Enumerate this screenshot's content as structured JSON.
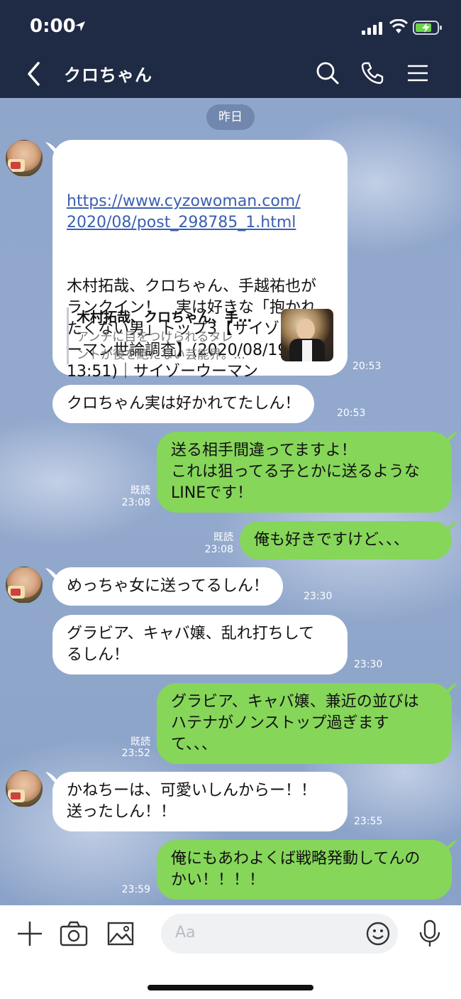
{
  "status_bar": {
    "time": "0:00"
  },
  "header": {
    "title": "クロちゃん"
  },
  "date_divider": "昨日",
  "messages": {
    "m1": {
      "link": "https://www.cyzowoman.com/\n2020/08/post_298785_1.html",
      "text": "木村拓哉、クロちゃん、手越祐也が\nランクイン！　実は好きな「抱かれ\nたくない男」トップ3【サイゾーウ\nーマン世論調査】(2020/08/19\n13:51)｜サイゾーウーマン",
      "preview_title": "木村拓哉、クロちゃん、手…",
      "preview_desc": "アンチに目をつけられるタレ\nントが後を絶たない芸能界。…",
      "time": "20:53"
    },
    "m2": {
      "text": "クロちゃん実は好かれてたしん！",
      "time": "20:53"
    },
    "m3": {
      "text": "送る相手間違ってますよ！\nこれは狙ってる子とかに送るような\nLINEです！",
      "read": "既読",
      "time": "23:08"
    },
    "m4": {
      "text": "俺も好きですけど、、、",
      "read": "既読",
      "time": "23:08"
    },
    "m5": {
      "text": "めっちゃ女に送ってるしん！",
      "time": "23:30"
    },
    "m6": {
      "text": "グラビア、キャバ嬢、乱れ打ちして\nるしん！",
      "time": "23:30"
    },
    "m7": {
      "text": "グラビア、キャバ嬢、兼近の並びは\nハテナがノンストップ過ぎます\nて、、、",
      "read": "既読",
      "time": "23:52"
    },
    "m8": {
      "text": "かねちーは、可愛いしんからー！！\n送ったしん！！",
      "time": "23:55"
    },
    "m9": {
      "text": "俺にもあわよくば戦略発動してんの\nかい！！！！",
      "time": "23:59"
    }
  },
  "input": {
    "placeholder": "Aa"
  },
  "colors": {
    "header_bg": "#1f2a44",
    "outgoing_bubble": "#86d65a",
    "incoming_bubble": "#ffffff",
    "chat_bg": "#8fa6cb"
  }
}
